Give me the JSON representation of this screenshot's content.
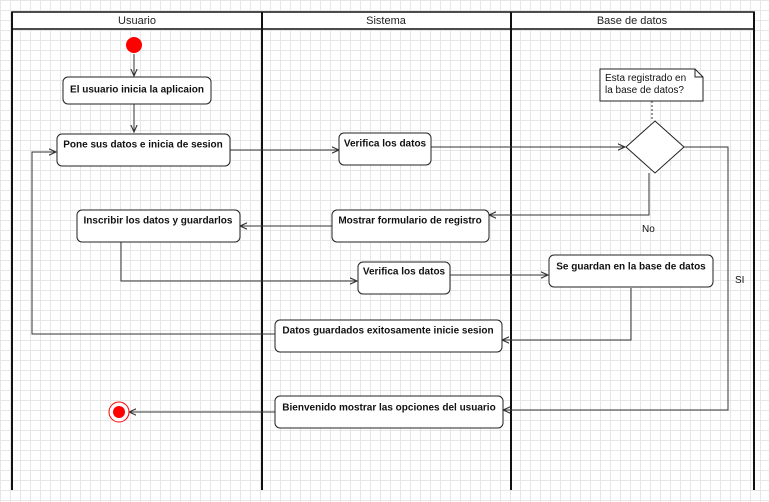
{
  "lanes": [
    "Usuario",
    "Sistema",
    "Base de datos"
  ],
  "nodes": {
    "inicia_app": "El usuario inicia la aplicaion",
    "pone_datos": "Pone sus datos e inicia de sesion",
    "verifica_1": "Verifica los datos",
    "mostrar_form": "Mostrar formulario de registro",
    "inscribir": "Inscribir los datos y guardarlos",
    "verifica_2": "Verifica los datos",
    "se_guardan": "Se guardan en la base de datos",
    "datos_guardados": "Datos guardados exitosamente inicie sesion",
    "bienvenido": "Bienvenido mostrar las opciones del usuario"
  },
  "note": [
    "Esta registrado en",
    "la base de datos?"
  ],
  "edge_labels": {
    "no": "No",
    "si": "SI"
  },
  "colors": {
    "start": "#ff0000",
    "end": "#ff0000",
    "line": "#333333"
  }
}
